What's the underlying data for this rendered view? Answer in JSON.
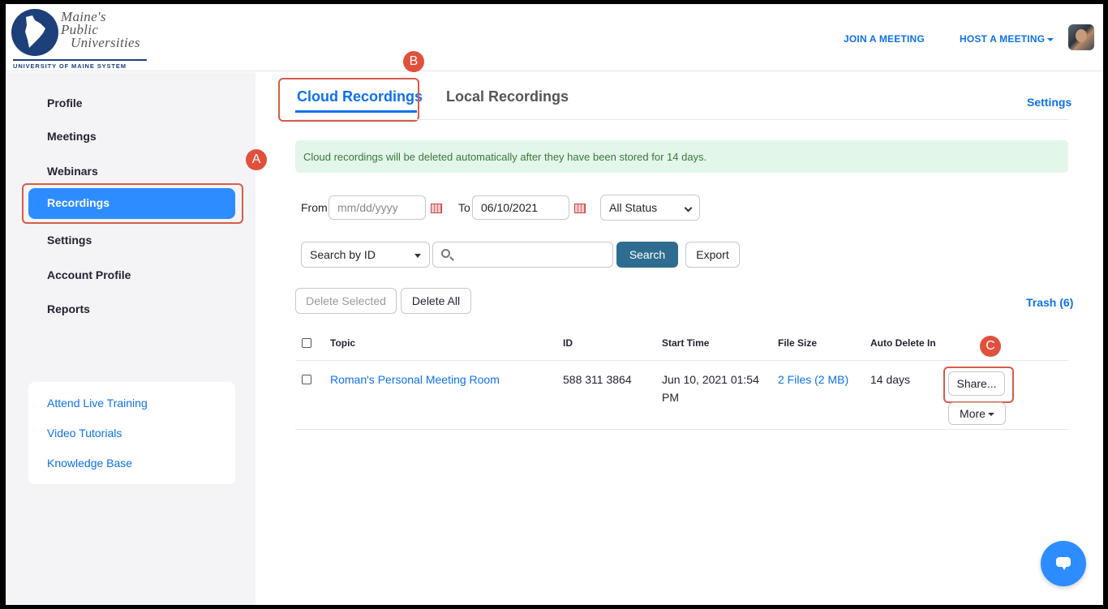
{
  "header": {
    "logo": {
      "line1": "Maine's",
      "line2": "Public",
      "line3": "Universities",
      "system": "UNIVERSITY OF MAINE SYSTEM"
    },
    "join_meeting": "JOIN A MEETING",
    "host_meeting": "HOST A MEETING"
  },
  "sidebar": {
    "items": [
      {
        "label": "Profile"
      },
      {
        "label": "Meetings"
      },
      {
        "label": "Webinars"
      },
      {
        "label": "Recordings",
        "active": true
      },
      {
        "label": "Settings"
      },
      {
        "label": "Account Profile"
      },
      {
        "label": "Reports"
      }
    ],
    "links": [
      {
        "label": "Attend Live Training"
      },
      {
        "label": "Video Tutorials"
      },
      {
        "label": "Knowledge Base"
      }
    ]
  },
  "annotations": {
    "a": "A",
    "b": "B",
    "c": "C"
  },
  "tabs": {
    "cloud": "Cloud Recordings",
    "local": "Local Recordings",
    "settings": "Settings"
  },
  "alert": "Cloud recordings will be deleted automatically after they have been stored for 14 days.",
  "filters": {
    "from_label": "From",
    "from_placeholder": "mm/dd/yyyy",
    "to_label": "To",
    "to_value": "06/10/2021",
    "status": "All Status",
    "search_by": "Search by ID",
    "search_value": "",
    "search_button": "Search",
    "export_button": "Export"
  },
  "actions": {
    "delete_selected": "Delete Selected",
    "delete_all": "Delete All",
    "trash": "Trash (6)"
  },
  "table": {
    "headers": {
      "topic": "Topic",
      "id": "ID",
      "start": "Start Time",
      "size": "File Size",
      "auto_delete": "Auto Delete In"
    },
    "rows": [
      {
        "topic": "Roman's Personal Meeting Room",
        "id": "588 311 3864",
        "start_line1": "Jun 10, 2021 01:54",
        "start_line2": "PM",
        "size": "2 Files (2 MB)",
        "auto_delete": "14 days",
        "share": "Share...",
        "more": "More"
      }
    ]
  },
  "colors": {
    "brand": "#0e71eb",
    "active_nav": "#2d8cff",
    "annotation": "#d75b4a",
    "alert_bg": "#e3f6ea",
    "alert_text": "#3c763d"
  }
}
